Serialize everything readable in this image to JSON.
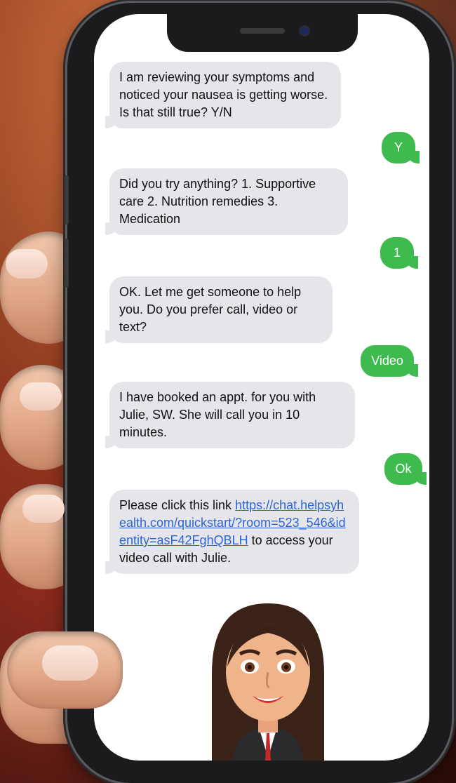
{
  "messages": [
    {
      "dir": "in",
      "text": "I am reviewing your symptoms and noticed your nausea is getting worse. Is that still true? Y/N"
    },
    {
      "dir": "out",
      "text": "Y"
    },
    {
      "dir": "in",
      "text": "Did you try anything? 1. Supportive care 2. Nutrition remedies 3. Medication"
    },
    {
      "dir": "out",
      "text": "1"
    },
    {
      "dir": "in",
      "text": "OK. Let me get someone to help you. Do you prefer call, video or text?"
    },
    {
      "dir": "out",
      "text": "Video"
    },
    {
      "dir": "in",
      "text": "I have booked an appt. for you with Julie, SW. She will call you in 10 minutes."
    },
    {
      "dir": "out",
      "text": "Ok"
    },
    {
      "dir": "in",
      "text_before": "Please click this link ",
      "link": "https://chat.helpsyhealth.com/quickstart/?room=523_546&identity=asF42FghQBLH",
      "text_after": " to access your video call with Julie."
    }
  ],
  "colors": {
    "incoming_bubble": "#e5e5ea",
    "outgoing_bubble": "#3fba4f",
    "link": "#2b66d9"
  },
  "avatar": {
    "icon": "female-agent-avatar"
  }
}
